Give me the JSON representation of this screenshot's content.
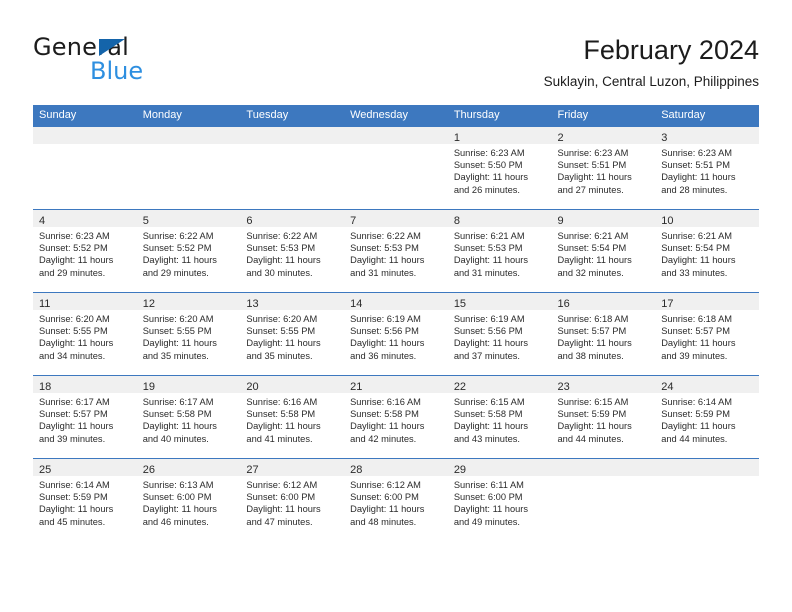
{
  "brand": {
    "name_part1": "General",
    "name_part2": "Blue",
    "triangle_color": "#1464aa",
    "blue_color": "#2e8fe0"
  },
  "header": {
    "title": "February 2024",
    "subtitle": "Suklayin, Central Luzon, Philippines"
  },
  "theme": {
    "header_bg": "#3d78bf",
    "daynum_band_bg": "#f0f0f0",
    "cell_bg": "#ffffff",
    "text": "#2b2b2b"
  },
  "weekdays": [
    "Sunday",
    "Monday",
    "Tuesday",
    "Wednesday",
    "Thursday",
    "Friday",
    "Saturday"
  ],
  "weeks": [
    [
      {
        "day": "",
        "blank": true
      },
      {
        "day": "",
        "blank": true
      },
      {
        "day": "",
        "blank": true
      },
      {
        "day": "",
        "blank": true
      },
      {
        "day": "1",
        "sunrise": "Sunrise: 6:23 AM",
        "sunset": "Sunset: 5:50 PM",
        "daylight1": "Daylight: 11 hours",
        "daylight2": "and 26 minutes."
      },
      {
        "day": "2",
        "sunrise": "Sunrise: 6:23 AM",
        "sunset": "Sunset: 5:51 PM",
        "daylight1": "Daylight: 11 hours",
        "daylight2": "and 27 minutes."
      },
      {
        "day": "3",
        "sunrise": "Sunrise: 6:23 AM",
        "sunset": "Sunset: 5:51 PM",
        "daylight1": "Daylight: 11 hours",
        "daylight2": "and 28 minutes."
      }
    ],
    [
      {
        "day": "4",
        "sunrise": "Sunrise: 6:23 AM",
        "sunset": "Sunset: 5:52 PM",
        "daylight1": "Daylight: 11 hours",
        "daylight2": "and 29 minutes."
      },
      {
        "day": "5",
        "sunrise": "Sunrise: 6:22 AM",
        "sunset": "Sunset: 5:52 PM",
        "daylight1": "Daylight: 11 hours",
        "daylight2": "and 29 minutes."
      },
      {
        "day": "6",
        "sunrise": "Sunrise: 6:22 AM",
        "sunset": "Sunset: 5:53 PM",
        "daylight1": "Daylight: 11 hours",
        "daylight2": "and 30 minutes."
      },
      {
        "day": "7",
        "sunrise": "Sunrise: 6:22 AM",
        "sunset": "Sunset: 5:53 PM",
        "daylight1": "Daylight: 11 hours",
        "daylight2": "and 31 minutes."
      },
      {
        "day": "8",
        "sunrise": "Sunrise: 6:21 AM",
        "sunset": "Sunset: 5:53 PM",
        "daylight1": "Daylight: 11 hours",
        "daylight2": "and 31 minutes."
      },
      {
        "day": "9",
        "sunrise": "Sunrise: 6:21 AM",
        "sunset": "Sunset: 5:54 PM",
        "daylight1": "Daylight: 11 hours",
        "daylight2": "and 32 minutes."
      },
      {
        "day": "10",
        "sunrise": "Sunrise: 6:21 AM",
        "sunset": "Sunset: 5:54 PM",
        "daylight1": "Daylight: 11 hours",
        "daylight2": "and 33 minutes."
      }
    ],
    [
      {
        "day": "11",
        "sunrise": "Sunrise: 6:20 AM",
        "sunset": "Sunset: 5:55 PM",
        "daylight1": "Daylight: 11 hours",
        "daylight2": "and 34 minutes."
      },
      {
        "day": "12",
        "sunrise": "Sunrise: 6:20 AM",
        "sunset": "Sunset: 5:55 PM",
        "daylight1": "Daylight: 11 hours",
        "daylight2": "and 35 minutes."
      },
      {
        "day": "13",
        "sunrise": "Sunrise: 6:20 AM",
        "sunset": "Sunset: 5:55 PM",
        "daylight1": "Daylight: 11 hours",
        "daylight2": "and 35 minutes."
      },
      {
        "day": "14",
        "sunrise": "Sunrise: 6:19 AM",
        "sunset": "Sunset: 5:56 PM",
        "daylight1": "Daylight: 11 hours",
        "daylight2": "and 36 minutes."
      },
      {
        "day": "15",
        "sunrise": "Sunrise: 6:19 AM",
        "sunset": "Sunset: 5:56 PM",
        "daylight1": "Daylight: 11 hours",
        "daylight2": "and 37 minutes."
      },
      {
        "day": "16",
        "sunrise": "Sunrise: 6:18 AM",
        "sunset": "Sunset: 5:57 PM",
        "daylight1": "Daylight: 11 hours",
        "daylight2": "and 38 minutes."
      },
      {
        "day": "17",
        "sunrise": "Sunrise: 6:18 AM",
        "sunset": "Sunset: 5:57 PM",
        "daylight1": "Daylight: 11 hours",
        "daylight2": "and 39 minutes."
      }
    ],
    [
      {
        "day": "18",
        "sunrise": "Sunrise: 6:17 AM",
        "sunset": "Sunset: 5:57 PM",
        "daylight1": "Daylight: 11 hours",
        "daylight2": "and 39 minutes."
      },
      {
        "day": "19",
        "sunrise": "Sunrise: 6:17 AM",
        "sunset": "Sunset: 5:58 PM",
        "daylight1": "Daylight: 11 hours",
        "daylight2": "and 40 minutes."
      },
      {
        "day": "20",
        "sunrise": "Sunrise: 6:16 AM",
        "sunset": "Sunset: 5:58 PM",
        "daylight1": "Daylight: 11 hours",
        "daylight2": "and 41 minutes."
      },
      {
        "day": "21",
        "sunrise": "Sunrise: 6:16 AM",
        "sunset": "Sunset: 5:58 PM",
        "daylight1": "Daylight: 11 hours",
        "daylight2": "and 42 minutes."
      },
      {
        "day": "22",
        "sunrise": "Sunrise: 6:15 AM",
        "sunset": "Sunset: 5:58 PM",
        "daylight1": "Daylight: 11 hours",
        "daylight2": "and 43 minutes."
      },
      {
        "day": "23",
        "sunrise": "Sunrise: 6:15 AM",
        "sunset": "Sunset: 5:59 PM",
        "daylight1": "Daylight: 11 hours",
        "daylight2": "and 44 minutes."
      },
      {
        "day": "24",
        "sunrise": "Sunrise: 6:14 AM",
        "sunset": "Sunset: 5:59 PM",
        "daylight1": "Daylight: 11 hours",
        "daylight2": "and 44 minutes."
      }
    ],
    [
      {
        "day": "25",
        "sunrise": "Sunrise: 6:14 AM",
        "sunset": "Sunset: 5:59 PM",
        "daylight1": "Daylight: 11 hours",
        "daylight2": "and 45 minutes."
      },
      {
        "day": "26",
        "sunrise": "Sunrise: 6:13 AM",
        "sunset": "Sunset: 6:00 PM",
        "daylight1": "Daylight: 11 hours",
        "daylight2": "and 46 minutes."
      },
      {
        "day": "27",
        "sunrise": "Sunrise: 6:12 AM",
        "sunset": "Sunset: 6:00 PM",
        "daylight1": "Daylight: 11 hours",
        "daylight2": "and 47 minutes."
      },
      {
        "day": "28",
        "sunrise": "Sunrise: 6:12 AM",
        "sunset": "Sunset: 6:00 PM",
        "daylight1": "Daylight: 11 hours",
        "daylight2": "and 48 minutes."
      },
      {
        "day": "29",
        "sunrise": "Sunrise: 6:11 AM",
        "sunset": "Sunset: 6:00 PM",
        "daylight1": "Daylight: 11 hours",
        "daylight2": "and 49 minutes."
      },
      {
        "day": "",
        "blank": true
      },
      {
        "day": "",
        "blank": true
      }
    ]
  ]
}
